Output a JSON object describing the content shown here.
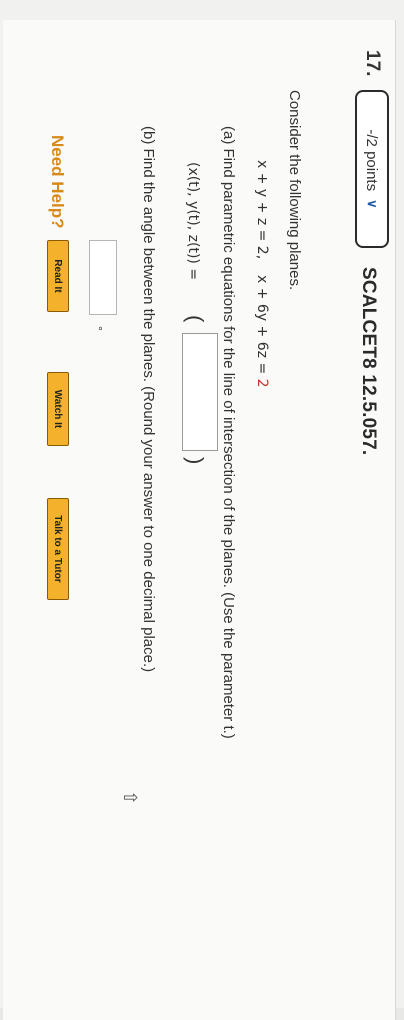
{
  "question": {
    "number": "17.",
    "points_label": "-/2 points",
    "code": "SCALCET8 12.5.057."
  },
  "content": {
    "intro": "Consider the following planes.",
    "plane1": "x + y + z = 2,",
    "plane2_prefix": "x + 6y + 6z = ",
    "plane2_rhs": "2",
    "part_a": "(a) Find parametric equations for the line of intersection of the planes. (Use the parameter t.)",
    "vector_label": "(x(t), y(t), z(t)) = ",
    "open_paren": "(",
    "close_paren": ")",
    "part_b": "(b) Find the angle between the planes. (Round your answer to one decimal place.)",
    "degree_symbol": "°"
  },
  "help": {
    "label": "Need Help?",
    "read_it": "Read It",
    "watch_it": "Watch It",
    "talk_to_tutor": "Talk to a Tutor"
  },
  "colors": {
    "accent_orange": "#f4b12b",
    "need_help": "#d88a16",
    "red_number": "#c0392b"
  }
}
